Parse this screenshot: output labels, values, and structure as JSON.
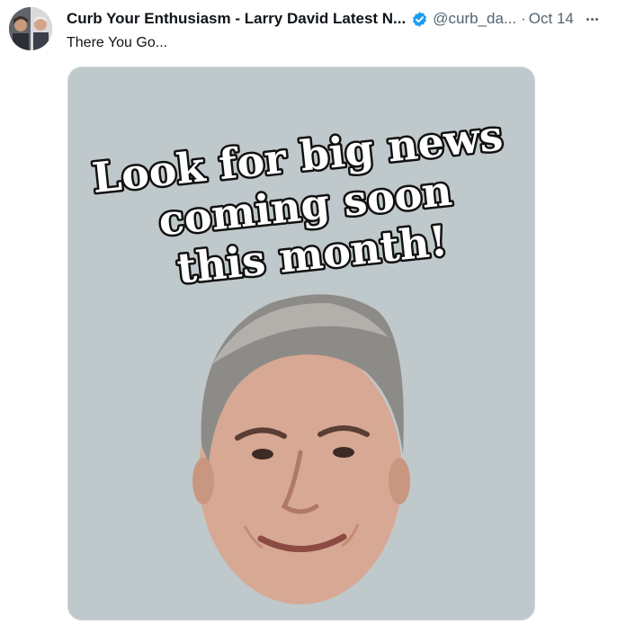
{
  "tweet": {
    "display_name": "Curb Your Enthusiasm - Larry David Latest N...",
    "handle": "@curb_da...",
    "separator": "·",
    "date": "Oct 14",
    "text": "There You Go...",
    "verified_icon": "verified-badge-icon",
    "more_icon": "more-options-icon"
  },
  "media": {
    "headline_lines": [
      "Look for big news",
      "coming soon",
      "this month!"
    ],
    "background_color": "#bfc8cb"
  },
  "colors": {
    "primary_text": "#0f1419",
    "secondary_text": "#536471",
    "verified_blue": "#1d9bf0",
    "border": "#cfd9de"
  }
}
